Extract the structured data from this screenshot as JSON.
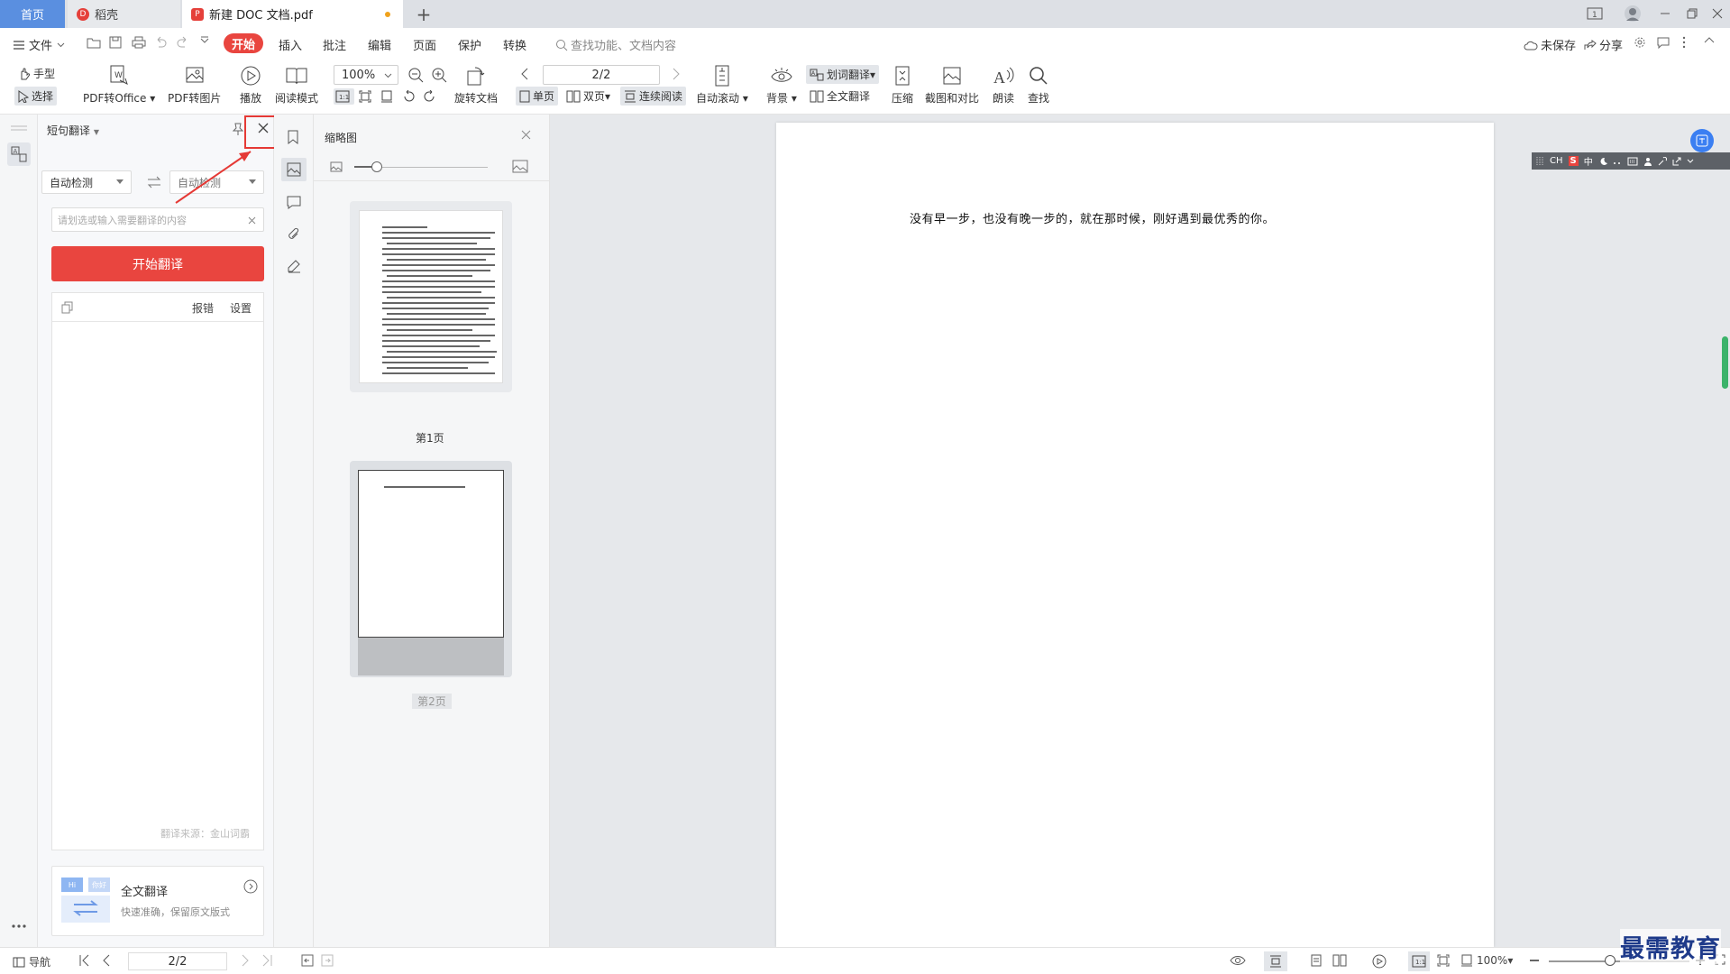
{
  "tabs": {
    "home": "首页",
    "daoke": "稻壳",
    "doc": "新建 DOC 文档.pdf",
    "add": "+"
  },
  "menubar": {
    "file": "文件",
    "items": [
      "开始",
      "插入",
      "批注",
      "编辑",
      "页面",
      "保护",
      "转换"
    ],
    "search_placeholder": "查找功能、文档内容",
    "unsaved": "未保存",
    "share": "分享"
  },
  "ribbon": {
    "hand": "手型",
    "select": "选择",
    "pdf_to_office": "PDF转Office",
    "pdf_to_image": "PDF转图片",
    "play": "播放",
    "read_mode": "阅读模式",
    "zoom": "100%",
    "rotate": "旋转文档",
    "page_indicator": "2/2",
    "single_page": "单页",
    "double_page": "双页",
    "continuous": "连续阅读",
    "auto_scroll": "自动滚动",
    "background": "背景",
    "word_translate": "划词翻译",
    "full_translate": "全文翻译",
    "compress": "压缩",
    "screenshot_compare": "截图和对比",
    "read_aloud": "朗读",
    "find": "查找"
  },
  "translate_panel": {
    "title": "短句翻译",
    "source_lang": "自动检测",
    "target_lang": "自动检测",
    "input_placeholder": "请划选或输入需要翻译的内容",
    "start_button": "开始翻译",
    "report": "报错",
    "settings": "设置",
    "source_note": "翻译来源：金山词霸",
    "full_title": "全文翻译",
    "full_subtitle": "快速准确，保留原文版式",
    "card_hi": "Hi",
    "card_nihao": "你好"
  },
  "thumb_panel": {
    "title": "缩略图",
    "page1": "第1页",
    "page2": "第2页"
  },
  "document": {
    "text": "没有早一步，也没有晚一步的，就在那时候，刚好遇到最优秀的你。"
  },
  "ime": {
    "ch": "CH",
    "s": "S",
    "zh": "中"
  },
  "statusbar": {
    "nav": "导航",
    "page": "2/2",
    "zoom": "100%"
  },
  "watermark": "最需教育",
  "colors": {
    "accent_red": "#e9453f",
    "home_tab": "#5a8fe0",
    "annotation": "#e53935"
  }
}
